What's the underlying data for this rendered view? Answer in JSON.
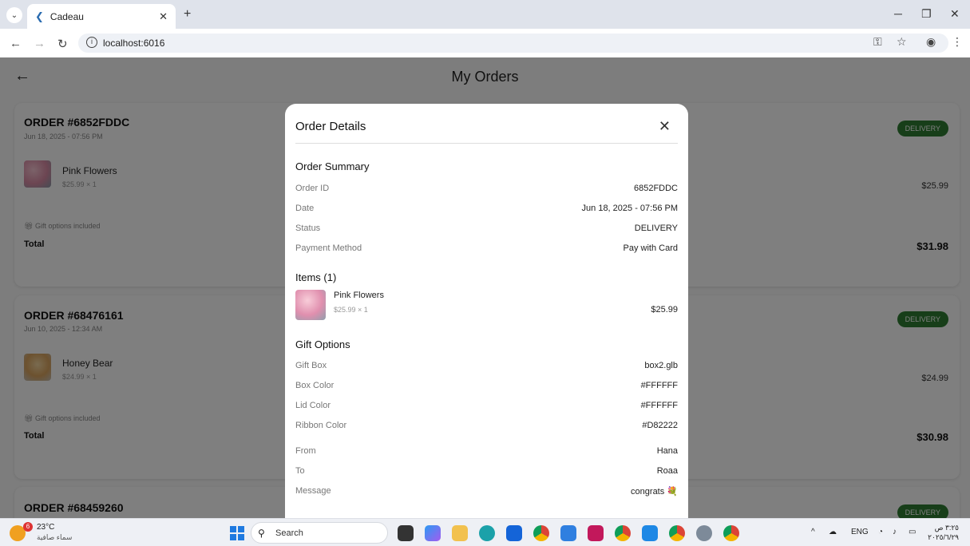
{
  "browser": {
    "tab_title": "Cadeau",
    "url": "localhost:6016"
  },
  "app": {
    "page_title": "My Orders"
  },
  "orders": [
    {
      "title": "ORDER #6852FDDC",
      "date": "Jun 18, 2025 - 07:56 PM",
      "status": "DELIVERY",
      "item_name": "Pink Flowers",
      "item_sub": "$25.99 × 1",
      "item_price": "$25.99",
      "gift_line": "Gift options included",
      "total_label": "Total",
      "total": "$31.98"
    },
    {
      "title": "ORDER #68476161",
      "date": "Jun 10, 2025 - 12:34 AM",
      "status": "DELIVERY",
      "item_name": "Honey Bear",
      "item_sub": "$24.99 × 1",
      "item_price": "$24.99",
      "gift_line": "Gift options included",
      "total_label": "Total",
      "total": "$30.98"
    },
    {
      "title": "ORDER #68459260",
      "status": "DELIVERY"
    }
  ],
  "modal": {
    "title": "Order Details",
    "summary_heading": "Order Summary",
    "summary": [
      {
        "k": "Order ID",
        "v": "6852FDDC"
      },
      {
        "k": "Date",
        "v": "Jun 18, 2025 - 07:56 PM"
      },
      {
        "k": "Status",
        "v": "DELIVERY"
      },
      {
        "k": "Payment Method",
        "v": "Pay with Card"
      }
    ],
    "items_heading": "Items (1)",
    "item": {
      "name": "Pink Flowers",
      "sub": "$25.99 × 1",
      "price": "$25.99"
    },
    "gift_heading": "Gift Options",
    "gift": [
      {
        "k": "Gift Box",
        "v": "box2.glb"
      },
      {
        "k": "Box Color",
        "v": "#FFFFFF"
      },
      {
        "k": "Lid Color",
        "v": "#FFFFFF"
      },
      {
        "k": "Ribbon Color",
        "v": "#D82222"
      },
      {
        "k": "From",
        "v": "Hana"
      },
      {
        "k": "To",
        "v": "Roaa"
      },
      {
        "k": "Message",
        "v": "congrats 💐"
      }
    ]
  },
  "taskbar": {
    "weather_badge": "6",
    "weather_temp": "23°C",
    "weather_desc": "سماء صافية",
    "search_label": "Search",
    "lang": "ENG",
    "time": "٣:٢٥ ص",
    "date": "٢٠٢٥/٦/٢٩"
  },
  "colors": {
    "badge_green": "#2e7d32",
    "overlay": "rgba(0,0,0,0.5)"
  }
}
